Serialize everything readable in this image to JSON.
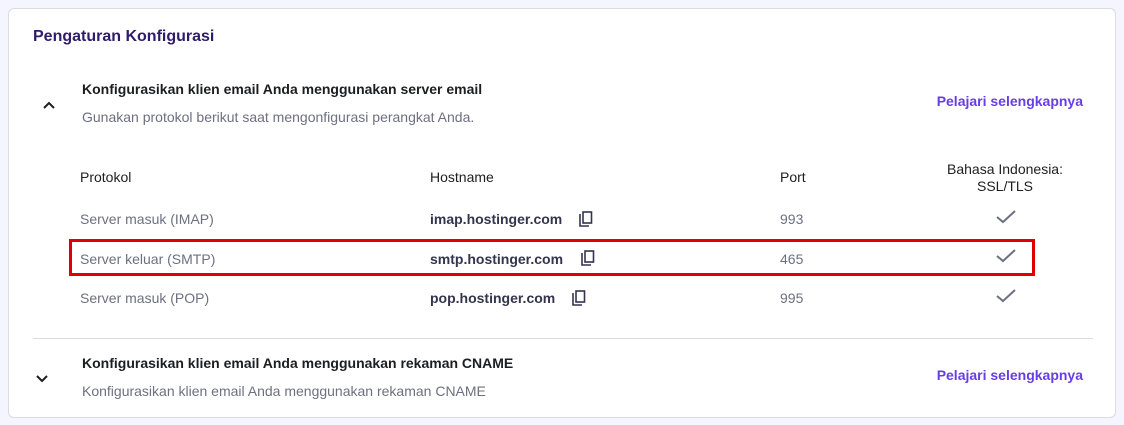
{
  "page_title": "Pengaturan Konfigurasi",
  "sections": [
    {
      "title": "Konfigurasikan klien email Anda menggunakan server email",
      "subtitle": "Gunakan protokol berikut saat mengonfigurasi perangkat Anda.",
      "link": "Pelajari selengkapnya",
      "expanded": true
    },
    {
      "title": "Konfigurasikan klien email Anda menggunakan rekaman CNAME",
      "subtitle": "Konfigurasikan klien email Anda menggunakan rekaman CNAME",
      "link": "Pelajari selengkapnya",
      "expanded": false
    }
  ],
  "table": {
    "headers": {
      "protocol": "Protokol",
      "hostname": "Hostname",
      "port": "Port",
      "ssl_line1": "Bahasa Indonesia:",
      "ssl_line2": "SSL/TLS"
    },
    "rows": [
      {
        "protocol": "Server masuk (IMAP)",
        "hostname": "imap.hostinger.com",
        "port": "993",
        "ssl": true
      },
      {
        "protocol": "Server keluar (SMTP)",
        "hostname": "smtp.hostinger.com",
        "port": "465",
        "ssl": true,
        "highlighted": true
      },
      {
        "protocol": "Server masuk (POP)",
        "hostname": "pop.hostinger.com",
        "port": "995",
        "ssl": true
      }
    ]
  },
  "colors": {
    "accent": "#673de6",
    "highlight": "#e00000"
  }
}
